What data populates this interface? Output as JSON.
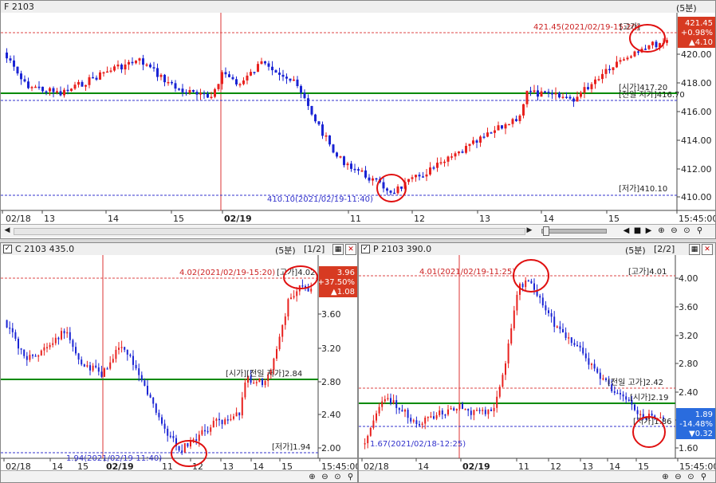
{
  "top": {
    "title": "F 2103",
    "interval": "(5분)",
    "price_badge": [
      "421.45",
      "+0.98%",
      "▲4.10"
    ],
    "hi_label": "421.45(2021/02/19-15:20)",
    "hi_tag": "[고가]",
    "lo_label": "410.10(2021/02/19-11:40)",
    "lo_tag": "[저가]410.10",
    "open_tag": "[시가]417.20",
    "prev_hi_tag": "[전일 저가]416.70",
    "yaxis": [
      "420.00",
      "418.00",
      "416.00",
      "414.00",
      "412.00",
      "410.00"
    ],
    "xaxis": [
      "02/18",
      "13",
      "14",
      "15",
      "02/19",
      "11",
      "12",
      "13",
      "14",
      "15",
      "15:45:00"
    ]
  },
  "call": {
    "title": "C 2103 435.0",
    "interval": "(5분)",
    "page": "[1/2]",
    "price_badge": [
      "3.96",
      "+37.50%",
      "▲1.08"
    ],
    "hi_label": "4.02(2021/02/19-15:20)",
    "hi_tag": "[고가]4.02",
    "lo_label": "1.94(2021/02/19-11:40)",
    "lo_tag": "[저가]1.94",
    "mid_tag": "[시가][전일 저가]2.84",
    "yaxis": [
      "3.60",
      "3.20",
      "2.80",
      "2.40",
      "2.00"
    ],
    "xaxis": [
      "02/18",
      "14",
      "15",
      "02/19",
      "11",
      "12",
      "13",
      "14",
      "15",
      "15:45:00"
    ]
  },
  "put": {
    "title": "P 2103 390.0",
    "interval": "(5분)",
    "page": "[2/2]",
    "price_badge": [
      "1.89",
      "-14.48%",
      "▼0.32"
    ],
    "hi_label": "4.01(2021/02/19-11:25)",
    "hi_tag": "[고가]4.01",
    "lo_label": "1.67(2021/02/18-12:25)",
    "prev_hi_tag": "[전일 고가]2.42",
    "open_tag": "[시가]2.19",
    "low2_tag": "[저가]1.86",
    "yaxis": [
      "4.00",
      "3.60",
      "3.20",
      "2.80",
      "2.40",
      "2.00",
      "1.60"
    ],
    "xaxis": [
      "02/18",
      "14",
      "02/19",
      "11",
      "12",
      "13",
      "14",
      "15",
      "15:45:00"
    ]
  },
  "colors": {
    "up": "#e8211e",
    "down": "#1a24d4",
    "green": "#008a00",
    "badge_up": "#d73a22",
    "badge_down": "#2a6cde"
  }
}
